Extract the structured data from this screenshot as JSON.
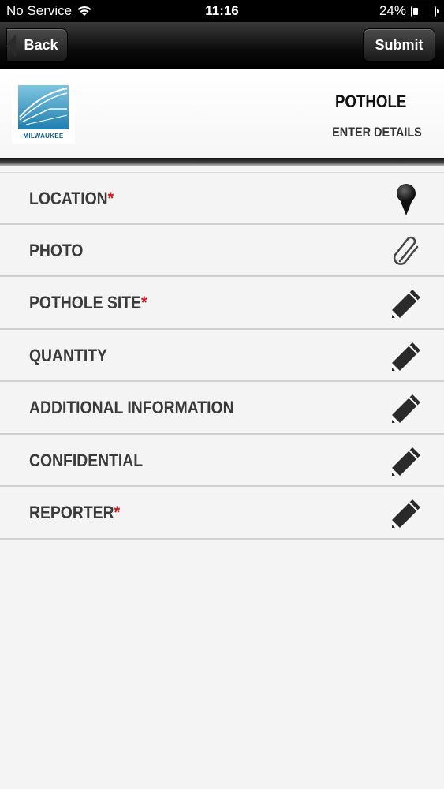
{
  "status_bar": {
    "carrier": "No Service",
    "time": "11:16",
    "battery_percent": "24%",
    "battery_level": 0.24
  },
  "nav": {
    "back_label": "Back",
    "submit_label": "Submit"
  },
  "header": {
    "logo_text": "MILWAUKEE",
    "title": "POTHOLE",
    "subtitle": "ENTER DETAILS"
  },
  "rows": [
    {
      "label": "LOCATION",
      "required": "*",
      "icon": "map-pin-icon"
    },
    {
      "label": "PHOTO",
      "required": "",
      "icon": "paperclip-icon"
    },
    {
      "label": "POTHOLE SITE",
      "required": "*",
      "icon": "pencil-icon"
    },
    {
      "label": "QUANTITY",
      "required": "",
      "icon": "pencil-icon"
    },
    {
      "label": "ADDITIONAL INFORMATION",
      "required": "",
      "icon": "pencil-icon"
    },
    {
      "label": "CONFIDENTIAL",
      "required": "",
      "icon": "pencil-icon"
    },
    {
      "label": "REPORTER",
      "required": "*",
      "icon": "pencil-icon"
    }
  ],
  "colors": {
    "required": "#d0181e",
    "nav_bg": "#000000",
    "row_bg": "#f4f4f4"
  }
}
